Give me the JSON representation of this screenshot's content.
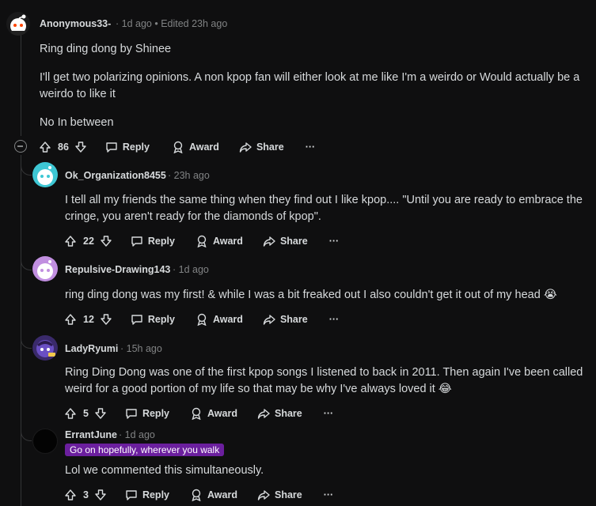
{
  "comments": [
    {
      "username": "Anonymous33-",
      "meta": "· 1d ago • Edited 23h ago",
      "paragraphs": [
        "Ring ding dong by Shinee",
        "I'll get two polarizing opinions. A non kpop fan will either look at me like I'm a weirdo or Would actually be a weirdo to like it",
        "No In between"
      ],
      "votes": "86",
      "reply_label": "Reply",
      "award_label": "Award",
      "share_label": "Share",
      "more_label": "···"
    },
    {
      "username": "Ok_Organization8455",
      "meta": "· 23h ago",
      "paragraphs": [
        "I tell all my friends the same thing when they find out I like kpop.... \"Until you are ready to embrace the cringe, you aren't ready for the diamonds of kpop\"."
      ],
      "votes": "22",
      "reply_label": "Reply",
      "award_label": "Award",
      "share_label": "Share",
      "more_label": "···"
    },
    {
      "username": "Repulsive-Drawing143",
      "meta": "· 1d ago",
      "paragraphs": [
        "ring ding dong was my first! & while I was a bit freaked out I also couldn't get it out of my head 😭"
      ],
      "votes": "12",
      "reply_label": "Reply",
      "award_label": "Award",
      "share_label": "Share",
      "more_label": "···"
    },
    {
      "username": "LadyRyumi",
      "meta": "· 15h ago",
      "paragraphs": [
        "Ring Ding Dong was one of the first kpop songs I listened to back in 2011. Then again I've been called weird for a good portion of my life so that may be why I've always loved it 😂"
      ],
      "votes": "5",
      "reply_label": "Reply",
      "award_label": "Award",
      "share_label": "Share",
      "more_label": "···"
    },
    {
      "username": "ErrantJune",
      "meta": "· 1d ago",
      "flair": "Go on hopefully, wherever you walk",
      "paragraphs": [
        "Lol we commented this simultaneously."
      ],
      "votes": "3",
      "reply_label": "Reply",
      "award_label": "Award",
      "share_label": "Share",
      "more_label": "···"
    }
  ],
  "colors": {
    "background": "#0f0f10",
    "text": "#d7dadc",
    "muted": "#818384",
    "flair": "#6b1f9e",
    "thread_line": "#343536"
  }
}
